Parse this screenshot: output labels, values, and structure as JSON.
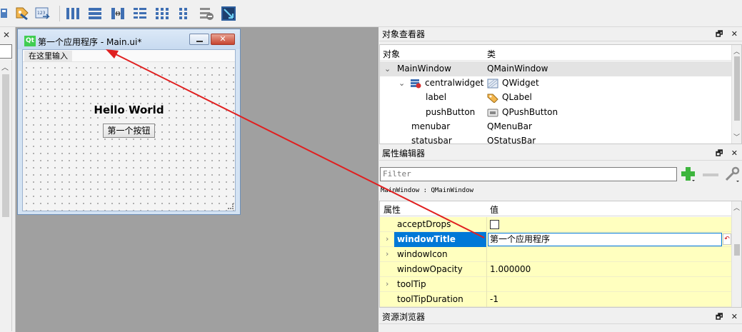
{
  "toolbar": {
    "icons": [
      "edit-tab-order-icon",
      "edit-buddies-icon",
      "edit-signals-icon",
      "layout-horizontal-icon",
      "layout-vertical-icon",
      "layout-splitter-horizontal-icon",
      "layout-form-icon",
      "layout-grid-icon",
      "layout-splitter-vertical-icon",
      "break-layout-icon",
      "adjust-size-icon"
    ]
  },
  "left_panel": {
    "close_label": "✕"
  },
  "form_window": {
    "title": "第一个应用程序 - Main.ui*",
    "logo_text": "Qt",
    "menu_placeholder": "在这里输入",
    "label_text": "Hello World",
    "button_text": "第一个按钮",
    "close_label": "✕"
  },
  "object_inspector": {
    "title": "对象查看器",
    "columns": [
      "对象",
      "类"
    ],
    "rows": [
      {
        "object": "MainWindow",
        "class": "QMainWindow",
        "expanded": true
      },
      {
        "object": "centralwidget",
        "class": "QWidget",
        "expanded": true
      },
      {
        "object": "label",
        "class": "QLabel"
      },
      {
        "object": "pushButton",
        "class": "QPushButton"
      },
      {
        "object": "menubar",
        "class": "QMenuBar"
      },
      {
        "object": "statusbar",
        "class": "QStatusBar"
      }
    ]
  },
  "property_editor": {
    "title": "属性编辑器",
    "filter_placeholder": "Filter",
    "class_line": "MainWindow : QMainWindow",
    "columns": [
      "属性",
      "值"
    ],
    "rows": [
      {
        "name": "acceptDrops",
        "value": ""
      },
      {
        "name": "windowTitle",
        "value": "第一个应用程序"
      },
      {
        "name": "windowIcon",
        "value": ""
      },
      {
        "name": "windowOpacity",
        "value": "1.000000"
      },
      {
        "name": "toolTip",
        "value": ""
      },
      {
        "name": "toolTipDuration",
        "value": "-1"
      }
    ]
  },
  "resource_browser": {
    "title": "资源浏览器"
  },
  "dock_buttons": {
    "float": "🗗",
    "close": "✕"
  },
  "colors": {
    "annotation_arrow": "#e02020",
    "selection": "#0078d7",
    "property_row": "#ffffbf"
  }
}
